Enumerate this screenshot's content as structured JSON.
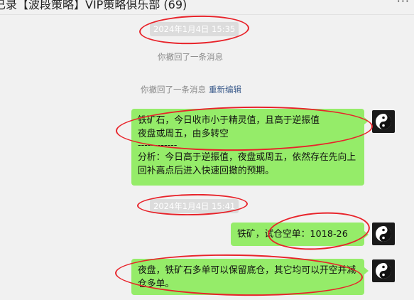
{
  "header": {
    "title": "已录【波段策略】VIP策略俱乐部 (69)",
    "more_label": "···"
  },
  "messages": {
    "time1": "2024年1月4日 15:35",
    "recall1": "你撤回了一条消息",
    "recall2": "你撤回了一条消息",
    "reedit": "重新编辑",
    "bubble1": {
      "line1": "铁矿石，今日收市小于精灵值，且高于逆振值",
      "line2": "夜盘或周五，由多转空",
      "divider": "------------",
      "analysis": "分析：今日高于逆振值，夜盘或周五，依然存在先向上回补高点后进入快速回撤的预期。"
    },
    "time2": "2024年1月4日 15:41",
    "bubble2": "铁矿，试仓空单：1018-26",
    "bubble3": "夜盘，铁矿石多单可以保留底仓，其它均可以开空并减仓多单。"
  },
  "avatar": {
    "icon": "yin-yang-icon",
    "colors": {
      "background": "#1a1a1a",
      "light": "#ffffff",
      "dark": "#111111"
    }
  },
  "colors": {
    "bubble": "#95ec69",
    "annotation": "#e8232a",
    "timestamp_bg": "#dcdcdc",
    "link": "#3c5c8c"
  }
}
